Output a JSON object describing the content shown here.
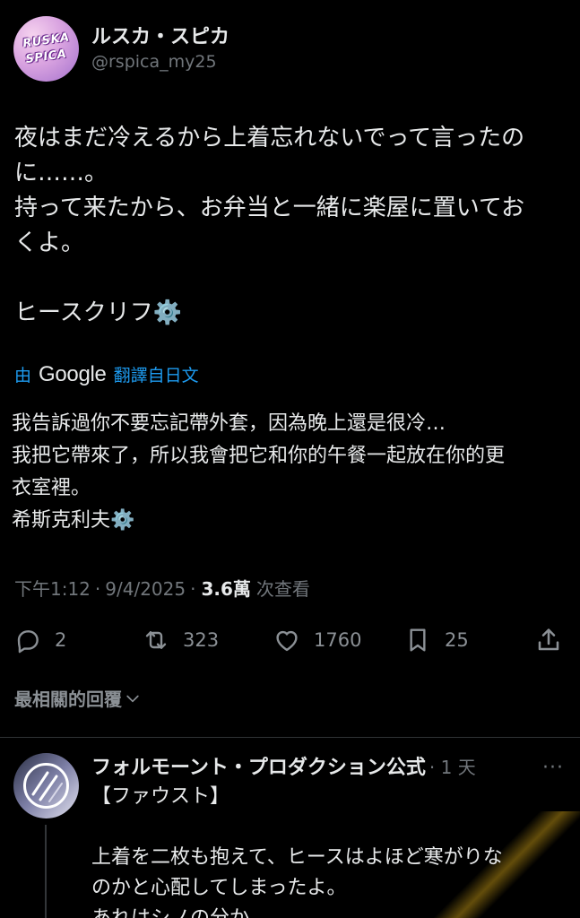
{
  "author": {
    "name": "ルスカ・スピカ",
    "handle": "@rspica_my25",
    "avatar_text_1": "RUSKA",
    "avatar_text_2": "SPICA"
  },
  "tweet": {
    "text": "夜はまだ冷えるから上着忘れないでって言ったの\nに……。\n持って来たから、お弁当と一緒に楽屋に置いてお\nくよ。\n\nヒースクリフ⚙️"
  },
  "translate": {
    "prefix": "由",
    "brand": "Google",
    "suffix": "翻譯自日文"
  },
  "translation": {
    "text": "我告訴過你不要忘記帶外套，因為晚上還是很冷…\n我把它帶來了，所以我會把它和你的午餐一起放在你的更\n衣室裡。\n希斯克利夫⚙️"
  },
  "meta": {
    "time": "下午1:12",
    "date": "9/4/2025",
    "separator": "·",
    "views_count": "3.6萬",
    "views_label": "次查看"
  },
  "actions": {
    "replies": "2",
    "retweets": "323",
    "likes": "1760",
    "bookmarks": "25",
    "icons": [
      "reply-icon",
      "retweet-icon",
      "like-icon",
      "bookmark-icon",
      "share-icon"
    ]
  },
  "sort": {
    "label": "最相關的回覆"
  },
  "reply": {
    "name": "フォルモーント・プロダクション公式",
    "time": "· 1 天",
    "more": "···",
    "text": "【ファウスト】\n\n上着を二枚も抱えて、ヒースはよほど寒がりな\nのかと心配してしまったよ。\nあれはシノの分か。"
  },
  "colors": {
    "background": "#000000",
    "text": "#e7e9ea",
    "muted": "#71767b",
    "accent": "#1d9bf0",
    "divider": "#2f3336"
  }
}
